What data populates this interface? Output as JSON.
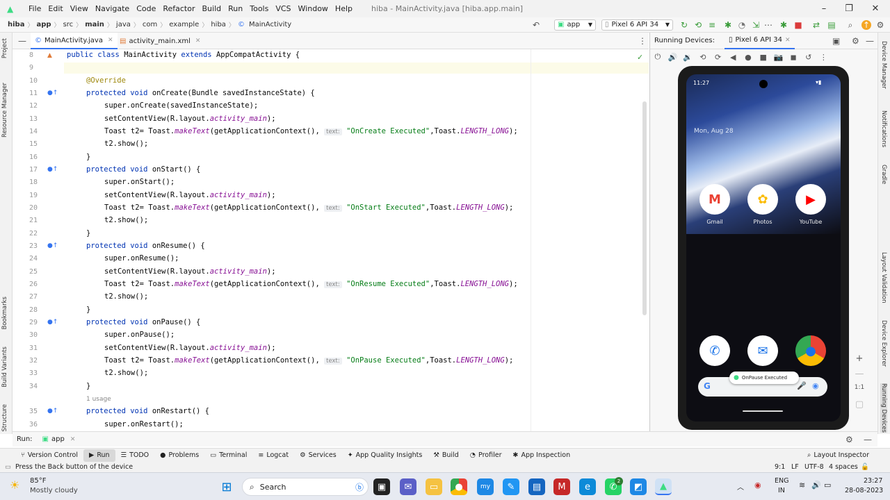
{
  "window": {
    "title": "hiba - MainActivity.java [hiba.app.main]"
  },
  "menu": [
    "File",
    "Edit",
    "View",
    "Navigate",
    "Code",
    "Refactor",
    "Build",
    "Run",
    "Tools",
    "VCS",
    "Window",
    "Help"
  ],
  "breadcrumbs": [
    "hiba",
    "app",
    "src",
    "main",
    "java",
    "com",
    "example",
    "hiba",
    "MainActivity"
  ],
  "toolbar": {
    "run_config": "app",
    "device": "Pixel 6 API 34"
  },
  "left_tools": [
    "Project",
    "Resource Manager",
    "Bookmarks",
    "Build Variants",
    "Structure"
  ],
  "right_tools": [
    "Device Manager",
    "Notifications",
    "Gradle",
    "Layout Validation",
    "Device Explorer",
    "Running Devices"
  ],
  "tabs": [
    {
      "label": "MainActivity.java"
    },
    {
      "label": "activity_main.xml"
    }
  ],
  "code": {
    "line_numbers": [
      "8",
      "9",
      "10",
      "11",
      "12",
      "13",
      "14",
      "15",
      "16",
      "17",
      "18",
      "19",
      "20",
      "21",
      "22",
      "23",
      "24",
      "25",
      "26",
      "27",
      "28",
      "29",
      "30",
      "31",
      "32",
      "33",
      "34",
      "35",
      "36"
    ],
    "hint": "text:",
    "usage": "1 usage",
    "l8": {
      "kw1": "public class ",
      "name": "MainActivity ",
      "kw2": "extends ",
      "rest": "AppCompatActivity {"
    },
    "annotation": "@Override",
    "methods": [
      {
        "sig": "onCreate(Bundle savedInstanceState) {",
        "super": "super.onCreate(savedInstanceState);",
        "msg": "\"OnCreate Executed\""
      },
      {
        "sig": "onStart() {",
        "super": "super.onStart();",
        "msg": "\"OnStart Executed\""
      },
      {
        "sig": "onResume() {",
        "super": "super.onResume();",
        "msg": "\"OnResume Executed\""
      },
      {
        "sig": "onPause() {",
        "super": "super.onPause();",
        "msg": "\"OnPause Executed\""
      }
    ],
    "restart_sig": "onRestart() {",
    "restart_super": "super.onRestart();",
    "protected_void": "protected void ",
    "set_content_a": "setContentView(R.layout.",
    "set_content_b": "activity_main",
    "set_content_c": ");",
    "toast_a": "Toast t2= Toast.",
    "toast_b": "makeText",
    "toast_c": "(getApplicationContext(), ",
    "toast_d": ",Toast.",
    "toast_e": "LENGTH_LONG",
    "toast_f": ");",
    "show": "t2.show();",
    "close": "}"
  },
  "devices_panel": {
    "title": "Running Devices:",
    "tab": "Pixel 6 API 34"
  },
  "phone": {
    "time": "11:27",
    "date": "Mon, Aug 28",
    "apps_row1": [
      "Gmail",
      "Photos",
      "YouTube"
    ],
    "toast": "OnPause Executed"
  },
  "run_bar": {
    "label": "Run:",
    "config": "app"
  },
  "tool_windows": [
    "Version Control",
    "Run",
    "TODO",
    "Problems",
    "Terminal",
    "Logcat",
    "Services",
    "App Quality Insights",
    "Build",
    "Profiler",
    "App Inspection",
    "Layout Inspector"
  ],
  "status": {
    "message": "Press the Back button of the device",
    "pos": "9:1",
    "le": "LF",
    "enc": "UTF-8",
    "indent": "4 spaces"
  },
  "taskbar": {
    "weather_temp": "85°F",
    "weather_desc": "Mostly cloudy",
    "search": "Search",
    "lang1": "ENG",
    "lang2": "IN",
    "time": "23:27",
    "date": "28-08-2023",
    "badge": "2"
  }
}
